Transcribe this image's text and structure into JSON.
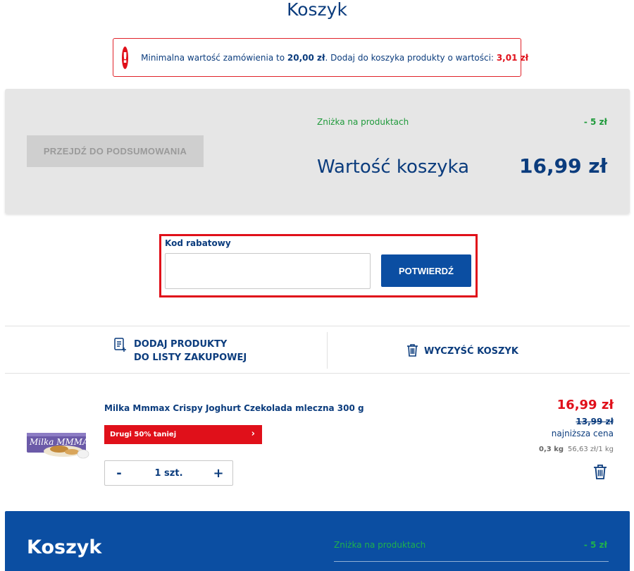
{
  "page": {
    "title": "Koszyk"
  },
  "alert": {
    "prefix": "Minimalna wartość zamówienia to",
    "min_value": "20,00 zł",
    "middle": ". Dodaj do koszyka produkty o wartości:",
    "missing_value": "3,01 zł"
  },
  "summary": {
    "checkout_button": "PRZEJDŹ DO PODSUMOWANIA",
    "discount_label": "Zniżka na produktach",
    "discount_value": "- 5 zł",
    "cart_label": "Wartość koszyka",
    "cart_value": "16,99 zł"
  },
  "coupon": {
    "label": "Kod rabatowy",
    "value": "",
    "placeholder": "",
    "confirm_button": "POTWIERDŹ"
  },
  "actions": {
    "add_to_list_line1": "DODAJ PRODUKTY",
    "add_to_list_line2": "DO LISTY ZAKUPOWEJ",
    "clear_cart": "WYCZYŚĆ KOSZYK"
  },
  "product": {
    "name": "Milka Mmmax Crispy Joghurt Czekolada mleczna 300 g",
    "image_brand": "Milka MMMAX",
    "promo": "Drugi 50% taniej",
    "quantity": "1 szt.",
    "minus": "-",
    "plus": "+",
    "price": "16,99 zł",
    "old_price": "13,99 zł",
    "lowest_label": "najniższa cena",
    "weight": "0,3 kg",
    "unit_price": "56,63 zł/1 kg"
  },
  "bottom_bar": {
    "title": "Koszyk",
    "discount_label": "Zniżka na produktach",
    "discount_value": "- 5 zł"
  },
  "colors": {
    "brand_blue": "#0b4ea2",
    "text_blue": "#0b3c7d",
    "alert_red": "#e0101a",
    "discount_green": "#1f9a3b"
  }
}
